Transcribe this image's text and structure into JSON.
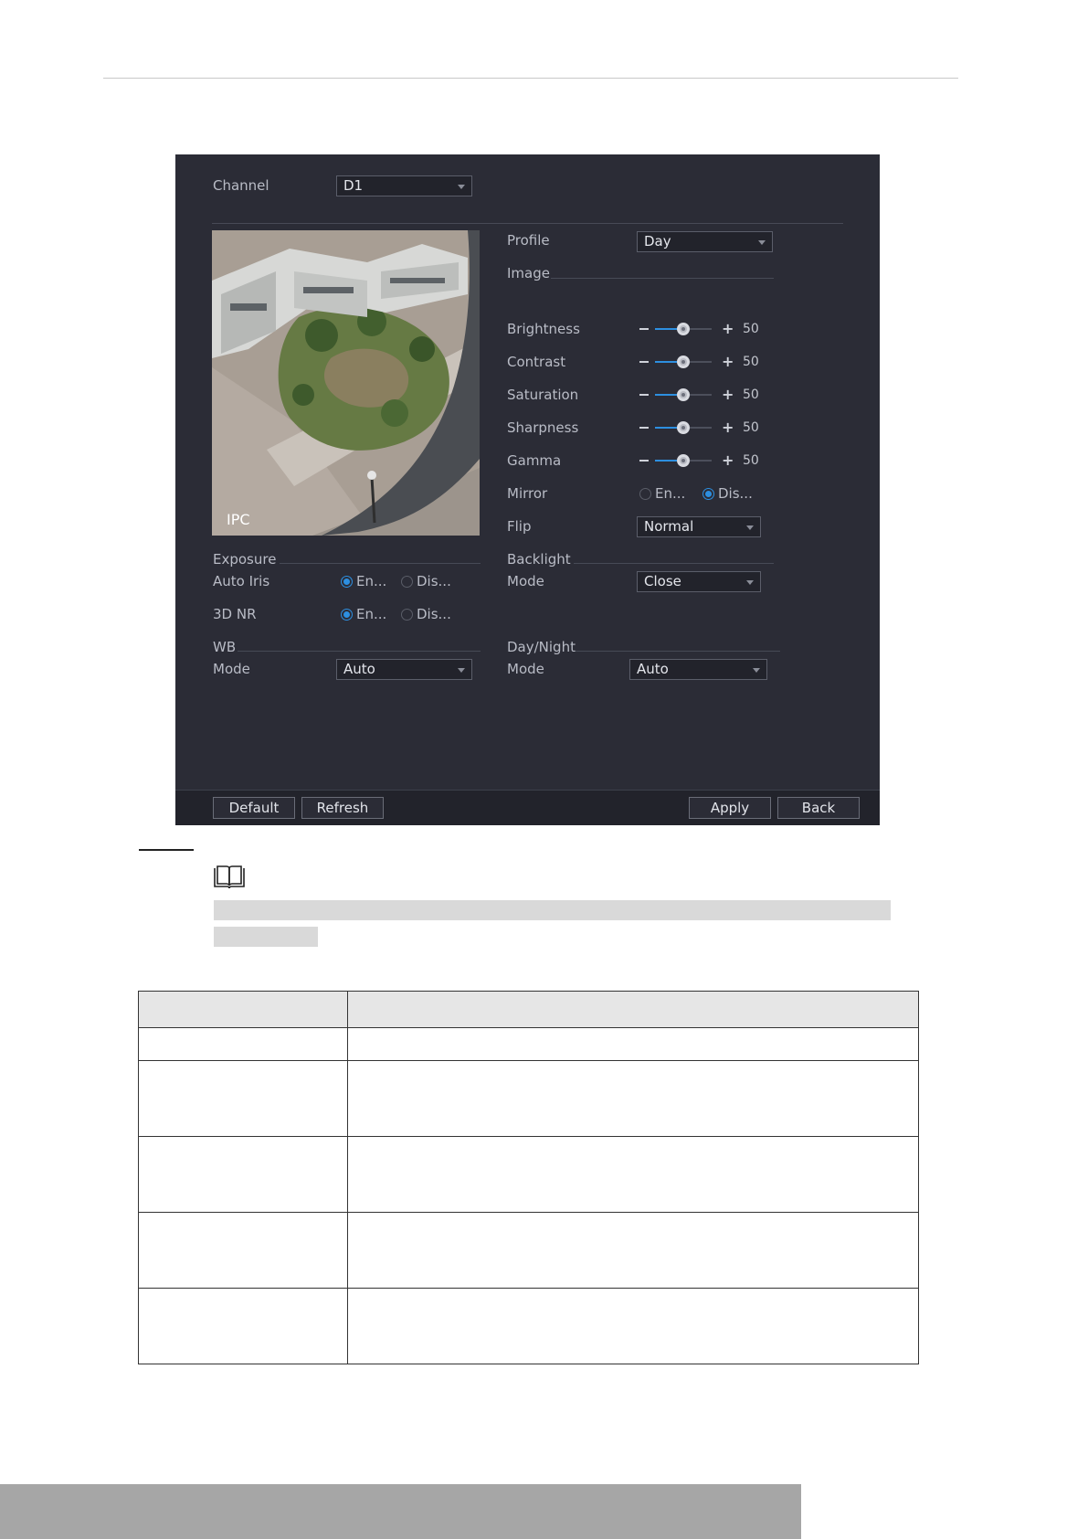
{
  "panel": {
    "channel": {
      "label": "Channel",
      "value": "D1"
    },
    "profile": {
      "label": "Profile",
      "value": "Day"
    },
    "image_section": "Image",
    "sliders": [
      {
        "label": "Brightness",
        "value": "50",
        "level": 0.5
      },
      {
        "label": "Contrast",
        "value": "50",
        "level": 0.5
      },
      {
        "label": "Saturation",
        "value": "50",
        "level": 0.5
      },
      {
        "label": "Sharpness",
        "value": "50",
        "level": 0.5
      },
      {
        "label": "Gamma",
        "value": "50",
        "level": 0.5
      }
    ],
    "mirror": {
      "label": "Mirror",
      "opt_enable": "En...",
      "opt_disable": "Dis...",
      "selected": "disable"
    },
    "flip": {
      "label": "Flip",
      "value": "Normal"
    },
    "preview": {
      "overlay": "IPC"
    },
    "exposure": {
      "section": "Exposure",
      "auto_iris": {
        "label": "Auto Iris",
        "opt_enable": "En...",
        "opt_disable": "Dis...",
        "selected": "enable"
      },
      "nr3d": {
        "label": "3D NR",
        "opt_enable": "En...",
        "opt_disable": "Dis...",
        "selected": "enable"
      }
    },
    "backlight": {
      "section": "Backlight",
      "mode_label": "Mode",
      "mode_value": "Close"
    },
    "wb": {
      "section": "WB",
      "mode_label": "Mode",
      "mode_value": "Auto"
    },
    "daynight": {
      "section": "Day/Night",
      "mode_label": "Mode",
      "mode_value": "Auto"
    },
    "buttons": {
      "default": "Default",
      "refresh": "Refresh",
      "apply": "Apply",
      "back": "Back"
    },
    "colors": {
      "accent": "#2d8fe0",
      "panel_bg": "#2b2c36"
    }
  },
  "note": {
    "icon": "book-icon"
  },
  "table": {
    "rows": 6,
    "columns": 2
  }
}
